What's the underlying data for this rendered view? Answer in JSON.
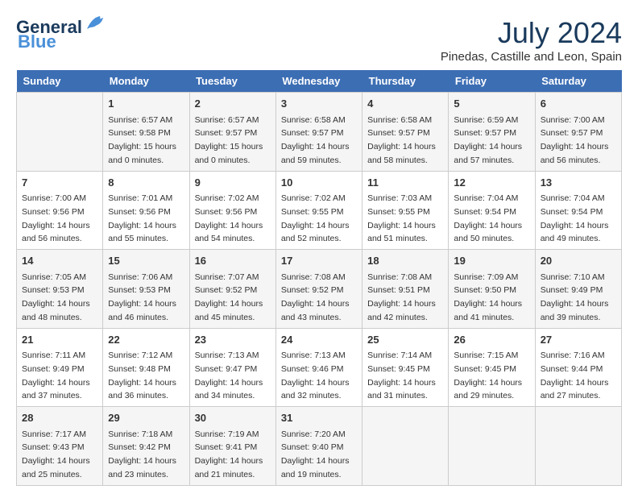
{
  "logo": {
    "general": "General",
    "blue": "Blue"
  },
  "title": "July 2024",
  "location": "Pinedas, Castille and Leon, Spain",
  "weekdays": [
    "Sunday",
    "Monday",
    "Tuesday",
    "Wednesday",
    "Thursday",
    "Friday",
    "Saturday"
  ],
  "weeks": [
    [
      {
        "day": "",
        "content": ""
      },
      {
        "day": "1",
        "content": "Sunrise: 6:57 AM\nSunset: 9:58 PM\nDaylight: 15 hours\nand 0 minutes."
      },
      {
        "day": "2",
        "content": "Sunrise: 6:57 AM\nSunset: 9:57 PM\nDaylight: 15 hours\nand 0 minutes."
      },
      {
        "day": "3",
        "content": "Sunrise: 6:58 AM\nSunset: 9:57 PM\nDaylight: 14 hours\nand 59 minutes."
      },
      {
        "day": "4",
        "content": "Sunrise: 6:58 AM\nSunset: 9:57 PM\nDaylight: 14 hours\nand 58 minutes."
      },
      {
        "day": "5",
        "content": "Sunrise: 6:59 AM\nSunset: 9:57 PM\nDaylight: 14 hours\nand 57 minutes."
      },
      {
        "day": "6",
        "content": "Sunrise: 7:00 AM\nSunset: 9:57 PM\nDaylight: 14 hours\nand 56 minutes."
      }
    ],
    [
      {
        "day": "7",
        "content": "Sunrise: 7:00 AM\nSunset: 9:56 PM\nDaylight: 14 hours\nand 56 minutes."
      },
      {
        "day": "8",
        "content": "Sunrise: 7:01 AM\nSunset: 9:56 PM\nDaylight: 14 hours\nand 55 minutes."
      },
      {
        "day": "9",
        "content": "Sunrise: 7:02 AM\nSunset: 9:56 PM\nDaylight: 14 hours\nand 54 minutes."
      },
      {
        "day": "10",
        "content": "Sunrise: 7:02 AM\nSunset: 9:55 PM\nDaylight: 14 hours\nand 52 minutes."
      },
      {
        "day": "11",
        "content": "Sunrise: 7:03 AM\nSunset: 9:55 PM\nDaylight: 14 hours\nand 51 minutes."
      },
      {
        "day": "12",
        "content": "Sunrise: 7:04 AM\nSunset: 9:54 PM\nDaylight: 14 hours\nand 50 minutes."
      },
      {
        "day": "13",
        "content": "Sunrise: 7:04 AM\nSunset: 9:54 PM\nDaylight: 14 hours\nand 49 minutes."
      }
    ],
    [
      {
        "day": "14",
        "content": "Sunrise: 7:05 AM\nSunset: 9:53 PM\nDaylight: 14 hours\nand 48 minutes."
      },
      {
        "day": "15",
        "content": "Sunrise: 7:06 AM\nSunset: 9:53 PM\nDaylight: 14 hours\nand 46 minutes."
      },
      {
        "day": "16",
        "content": "Sunrise: 7:07 AM\nSunset: 9:52 PM\nDaylight: 14 hours\nand 45 minutes."
      },
      {
        "day": "17",
        "content": "Sunrise: 7:08 AM\nSunset: 9:52 PM\nDaylight: 14 hours\nand 43 minutes."
      },
      {
        "day": "18",
        "content": "Sunrise: 7:08 AM\nSunset: 9:51 PM\nDaylight: 14 hours\nand 42 minutes."
      },
      {
        "day": "19",
        "content": "Sunrise: 7:09 AM\nSunset: 9:50 PM\nDaylight: 14 hours\nand 41 minutes."
      },
      {
        "day": "20",
        "content": "Sunrise: 7:10 AM\nSunset: 9:49 PM\nDaylight: 14 hours\nand 39 minutes."
      }
    ],
    [
      {
        "day": "21",
        "content": "Sunrise: 7:11 AM\nSunset: 9:49 PM\nDaylight: 14 hours\nand 37 minutes."
      },
      {
        "day": "22",
        "content": "Sunrise: 7:12 AM\nSunset: 9:48 PM\nDaylight: 14 hours\nand 36 minutes."
      },
      {
        "day": "23",
        "content": "Sunrise: 7:13 AM\nSunset: 9:47 PM\nDaylight: 14 hours\nand 34 minutes."
      },
      {
        "day": "24",
        "content": "Sunrise: 7:13 AM\nSunset: 9:46 PM\nDaylight: 14 hours\nand 32 minutes."
      },
      {
        "day": "25",
        "content": "Sunrise: 7:14 AM\nSunset: 9:45 PM\nDaylight: 14 hours\nand 31 minutes."
      },
      {
        "day": "26",
        "content": "Sunrise: 7:15 AM\nSunset: 9:45 PM\nDaylight: 14 hours\nand 29 minutes."
      },
      {
        "day": "27",
        "content": "Sunrise: 7:16 AM\nSunset: 9:44 PM\nDaylight: 14 hours\nand 27 minutes."
      }
    ],
    [
      {
        "day": "28",
        "content": "Sunrise: 7:17 AM\nSunset: 9:43 PM\nDaylight: 14 hours\nand 25 minutes."
      },
      {
        "day": "29",
        "content": "Sunrise: 7:18 AM\nSunset: 9:42 PM\nDaylight: 14 hours\nand 23 minutes."
      },
      {
        "day": "30",
        "content": "Sunrise: 7:19 AM\nSunset: 9:41 PM\nDaylight: 14 hours\nand 21 minutes."
      },
      {
        "day": "31",
        "content": "Sunrise: 7:20 AM\nSunset: 9:40 PM\nDaylight: 14 hours\nand 19 minutes."
      },
      {
        "day": "",
        "content": ""
      },
      {
        "day": "",
        "content": ""
      },
      {
        "day": "",
        "content": ""
      }
    ]
  ]
}
